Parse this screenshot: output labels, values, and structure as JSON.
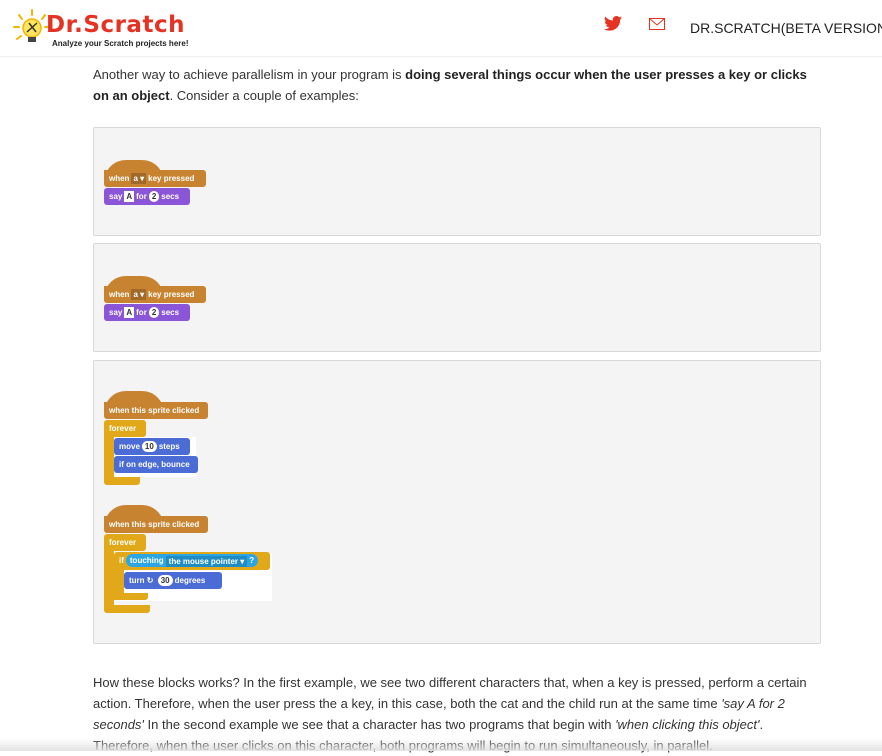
{
  "header": {
    "logo_text": "Dr.Scratch",
    "logo_tagline": "Analyze your Scratch projects here!",
    "site_title": "DR.SCRATCH(BETA VERSION)",
    "icons": [
      "twitter-icon",
      "mail-icon"
    ]
  },
  "intro": {
    "before": "Another way to achieve parallelism in your program is ",
    "bold": "doing several things occur when the user presses a key or clicks on an object",
    "after": ". Consider a couple of examples:"
  },
  "example1": {
    "hat": {
      "when": "when",
      "key": "a",
      "rest": "key pressed"
    },
    "say": {
      "say": "say",
      "msg": "A",
      "for": "for",
      "secs_val": "2",
      "secs": "secs"
    }
  },
  "example2": {
    "hat": {
      "when": "when",
      "key": "a",
      "rest": "key pressed"
    },
    "say": {
      "say": "say",
      "msg": "A",
      "for": "for",
      "secs_val": "2",
      "secs": "secs"
    }
  },
  "example3": {
    "script1": {
      "hat": "when this sprite clicked",
      "forever": "forever",
      "move": {
        "label": "move",
        "val": "10",
        "unit": "steps"
      },
      "bounce": "if on edge, bounce"
    },
    "script2": {
      "hat": "when this sprite clicked",
      "forever": "forever",
      "if": "if",
      "touching": "touching",
      "target": "the mouse pointer",
      "question": "?",
      "turn": {
        "label": "turn",
        "val": "30",
        "unit": "degrees"
      }
    }
  },
  "explanation": {
    "t1": "How these blocks works? In the first example, we see two different characters that, when a key is pressed, perform a certain action. Therefore, when the user press the a key, in this case, both the cat and the child run at the same time ",
    "i1": "'say A for 2 seconds'",
    "t2": " In the second example we see that a character has two programs that begin with ",
    "i2": "'when clicking this object'",
    "t3": ". Therefore, when the user clicks on this character, both programs will begin to run simultaneously, in parallel."
  },
  "colors": {
    "event": "#c88330",
    "looks": "#8a55d7",
    "motion": "#4a6cd4",
    "control": "#e1a91a",
    "sensing": "#2ca5e2",
    "brand_red": "#e53222"
  }
}
